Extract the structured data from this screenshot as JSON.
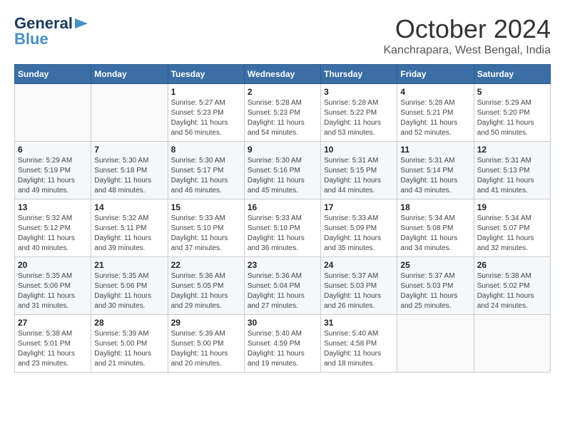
{
  "header": {
    "month_title": "October 2024",
    "subtitle": "Kanchrapara, West Bengal, India",
    "logo_general": "General",
    "logo_blue": "Blue"
  },
  "weekdays": [
    "Sunday",
    "Monday",
    "Tuesday",
    "Wednesday",
    "Thursday",
    "Friday",
    "Saturday"
  ],
  "weeks": [
    [
      {
        "day": "",
        "info": ""
      },
      {
        "day": "",
        "info": ""
      },
      {
        "day": "1",
        "info": "Sunrise: 5:27 AM\nSunset: 5:23 PM\nDaylight: 11 hours and 56 minutes."
      },
      {
        "day": "2",
        "info": "Sunrise: 5:28 AM\nSunset: 5:23 PM\nDaylight: 11 hours and 54 minutes."
      },
      {
        "day": "3",
        "info": "Sunrise: 5:28 AM\nSunset: 5:22 PM\nDaylight: 11 hours and 53 minutes."
      },
      {
        "day": "4",
        "info": "Sunrise: 5:28 AM\nSunset: 5:21 PM\nDaylight: 11 hours and 52 minutes."
      },
      {
        "day": "5",
        "info": "Sunrise: 5:29 AM\nSunset: 5:20 PM\nDaylight: 11 hours and 50 minutes."
      }
    ],
    [
      {
        "day": "6",
        "info": "Sunrise: 5:29 AM\nSunset: 5:19 PM\nDaylight: 11 hours and 49 minutes."
      },
      {
        "day": "7",
        "info": "Sunrise: 5:30 AM\nSunset: 5:18 PM\nDaylight: 11 hours and 48 minutes."
      },
      {
        "day": "8",
        "info": "Sunrise: 5:30 AM\nSunset: 5:17 PM\nDaylight: 11 hours and 46 minutes."
      },
      {
        "day": "9",
        "info": "Sunrise: 5:30 AM\nSunset: 5:16 PM\nDaylight: 11 hours and 45 minutes."
      },
      {
        "day": "10",
        "info": "Sunrise: 5:31 AM\nSunset: 5:15 PM\nDaylight: 11 hours and 44 minutes."
      },
      {
        "day": "11",
        "info": "Sunrise: 5:31 AM\nSunset: 5:14 PM\nDaylight: 11 hours and 43 minutes."
      },
      {
        "day": "12",
        "info": "Sunrise: 5:31 AM\nSunset: 5:13 PM\nDaylight: 11 hours and 41 minutes."
      }
    ],
    [
      {
        "day": "13",
        "info": "Sunrise: 5:32 AM\nSunset: 5:12 PM\nDaylight: 11 hours and 40 minutes."
      },
      {
        "day": "14",
        "info": "Sunrise: 5:32 AM\nSunset: 5:11 PM\nDaylight: 11 hours and 39 minutes."
      },
      {
        "day": "15",
        "info": "Sunrise: 5:33 AM\nSunset: 5:10 PM\nDaylight: 11 hours and 37 minutes."
      },
      {
        "day": "16",
        "info": "Sunrise: 5:33 AM\nSunset: 5:10 PM\nDaylight: 11 hours and 36 minutes."
      },
      {
        "day": "17",
        "info": "Sunrise: 5:33 AM\nSunset: 5:09 PM\nDaylight: 11 hours and 35 minutes."
      },
      {
        "day": "18",
        "info": "Sunrise: 5:34 AM\nSunset: 5:08 PM\nDaylight: 11 hours and 34 minutes."
      },
      {
        "day": "19",
        "info": "Sunrise: 5:34 AM\nSunset: 5:07 PM\nDaylight: 11 hours and 32 minutes."
      }
    ],
    [
      {
        "day": "20",
        "info": "Sunrise: 5:35 AM\nSunset: 5:06 PM\nDaylight: 11 hours and 31 minutes."
      },
      {
        "day": "21",
        "info": "Sunrise: 5:35 AM\nSunset: 5:06 PM\nDaylight: 11 hours and 30 minutes."
      },
      {
        "day": "22",
        "info": "Sunrise: 5:36 AM\nSunset: 5:05 PM\nDaylight: 11 hours and 29 minutes."
      },
      {
        "day": "23",
        "info": "Sunrise: 5:36 AM\nSunset: 5:04 PM\nDaylight: 11 hours and 27 minutes."
      },
      {
        "day": "24",
        "info": "Sunrise: 5:37 AM\nSunset: 5:03 PM\nDaylight: 11 hours and 26 minutes."
      },
      {
        "day": "25",
        "info": "Sunrise: 5:37 AM\nSunset: 5:03 PM\nDaylight: 11 hours and 25 minutes."
      },
      {
        "day": "26",
        "info": "Sunrise: 5:38 AM\nSunset: 5:02 PM\nDaylight: 11 hours and 24 minutes."
      }
    ],
    [
      {
        "day": "27",
        "info": "Sunrise: 5:38 AM\nSunset: 5:01 PM\nDaylight: 11 hours and 23 minutes."
      },
      {
        "day": "28",
        "info": "Sunrise: 5:39 AM\nSunset: 5:00 PM\nDaylight: 11 hours and 21 minutes."
      },
      {
        "day": "29",
        "info": "Sunrise: 5:39 AM\nSunset: 5:00 PM\nDaylight: 11 hours and 20 minutes."
      },
      {
        "day": "30",
        "info": "Sunrise: 5:40 AM\nSunset: 4:59 PM\nDaylight: 11 hours and 19 minutes."
      },
      {
        "day": "31",
        "info": "Sunrise: 5:40 AM\nSunset: 4:58 PM\nDaylight: 11 hours and 18 minutes."
      },
      {
        "day": "",
        "info": ""
      },
      {
        "day": "",
        "info": ""
      }
    ]
  ]
}
